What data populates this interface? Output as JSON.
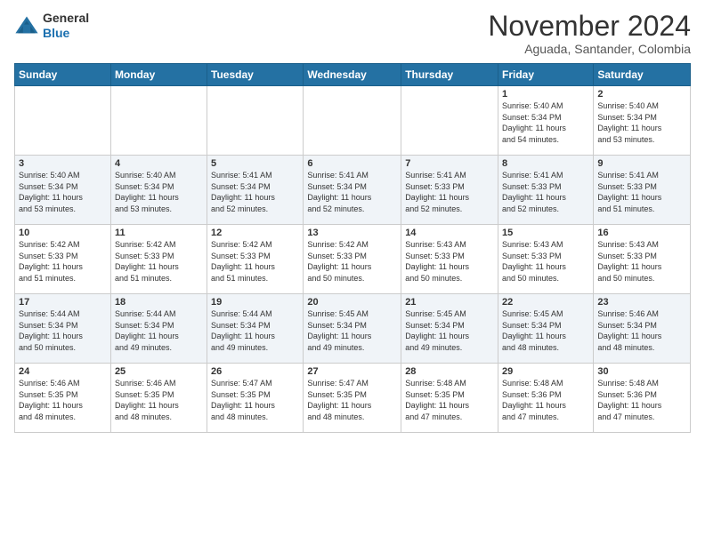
{
  "header": {
    "logo_general": "General",
    "logo_blue": "Blue",
    "month": "November 2024",
    "location": "Aguada, Santander, Colombia"
  },
  "calendar": {
    "days_of_week": [
      "Sunday",
      "Monday",
      "Tuesday",
      "Wednesday",
      "Thursday",
      "Friday",
      "Saturday"
    ],
    "weeks": [
      [
        {
          "day": "",
          "info": ""
        },
        {
          "day": "",
          "info": ""
        },
        {
          "day": "",
          "info": ""
        },
        {
          "day": "",
          "info": ""
        },
        {
          "day": "",
          "info": ""
        },
        {
          "day": "1",
          "info": "Sunrise: 5:40 AM\nSunset: 5:34 PM\nDaylight: 11 hours\nand 54 minutes."
        },
        {
          "day": "2",
          "info": "Sunrise: 5:40 AM\nSunset: 5:34 PM\nDaylight: 11 hours\nand 53 minutes."
        }
      ],
      [
        {
          "day": "3",
          "info": "Sunrise: 5:40 AM\nSunset: 5:34 PM\nDaylight: 11 hours\nand 53 minutes."
        },
        {
          "day": "4",
          "info": "Sunrise: 5:40 AM\nSunset: 5:34 PM\nDaylight: 11 hours\nand 53 minutes."
        },
        {
          "day": "5",
          "info": "Sunrise: 5:41 AM\nSunset: 5:34 PM\nDaylight: 11 hours\nand 52 minutes."
        },
        {
          "day": "6",
          "info": "Sunrise: 5:41 AM\nSunset: 5:34 PM\nDaylight: 11 hours\nand 52 minutes."
        },
        {
          "day": "7",
          "info": "Sunrise: 5:41 AM\nSunset: 5:33 PM\nDaylight: 11 hours\nand 52 minutes."
        },
        {
          "day": "8",
          "info": "Sunrise: 5:41 AM\nSunset: 5:33 PM\nDaylight: 11 hours\nand 52 minutes."
        },
        {
          "day": "9",
          "info": "Sunrise: 5:41 AM\nSunset: 5:33 PM\nDaylight: 11 hours\nand 51 minutes."
        }
      ],
      [
        {
          "day": "10",
          "info": "Sunrise: 5:42 AM\nSunset: 5:33 PM\nDaylight: 11 hours\nand 51 minutes."
        },
        {
          "day": "11",
          "info": "Sunrise: 5:42 AM\nSunset: 5:33 PM\nDaylight: 11 hours\nand 51 minutes."
        },
        {
          "day": "12",
          "info": "Sunrise: 5:42 AM\nSunset: 5:33 PM\nDaylight: 11 hours\nand 51 minutes."
        },
        {
          "day": "13",
          "info": "Sunrise: 5:42 AM\nSunset: 5:33 PM\nDaylight: 11 hours\nand 50 minutes."
        },
        {
          "day": "14",
          "info": "Sunrise: 5:43 AM\nSunset: 5:33 PM\nDaylight: 11 hours\nand 50 minutes."
        },
        {
          "day": "15",
          "info": "Sunrise: 5:43 AM\nSunset: 5:33 PM\nDaylight: 11 hours\nand 50 minutes."
        },
        {
          "day": "16",
          "info": "Sunrise: 5:43 AM\nSunset: 5:33 PM\nDaylight: 11 hours\nand 50 minutes."
        }
      ],
      [
        {
          "day": "17",
          "info": "Sunrise: 5:44 AM\nSunset: 5:34 PM\nDaylight: 11 hours\nand 50 minutes."
        },
        {
          "day": "18",
          "info": "Sunrise: 5:44 AM\nSunset: 5:34 PM\nDaylight: 11 hours\nand 49 minutes."
        },
        {
          "day": "19",
          "info": "Sunrise: 5:44 AM\nSunset: 5:34 PM\nDaylight: 11 hours\nand 49 minutes."
        },
        {
          "day": "20",
          "info": "Sunrise: 5:45 AM\nSunset: 5:34 PM\nDaylight: 11 hours\nand 49 minutes."
        },
        {
          "day": "21",
          "info": "Sunrise: 5:45 AM\nSunset: 5:34 PM\nDaylight: 11 hours\nand 49 minutes."
        },
        {
          "day": "22",
          "info": "Sunrise: 5:45 AM\nSunset: 5:34 PM\nDaylight: 11 hours\nand 48 minutes."
        },
        {
          "day": "23",
          "info": "Sunrise: 5:46 AM\nSunset: 5:34 PM\nDaylight: 11 hours\nand 48 minutes."
        }
      ],
      [
        {
          "day": "24",
          "info": "Sunrise: 5:46 AM\nSunset: 5:35 PM\nDaylight: 11 hours\nand 48 minutes."
        },
        {
          "day": "25",
          "info": "Sunrise: 5:46 AM\nSunset: 5:35 PM\nDaylight: 11 hours\nand 48 minutes."
        },
        {
          "day": "26",
          "info": "Sunrise: 5:47 AM\nSunset: 5:35 PM\nDaylight: 11 hours\nand 48 minutes."
        },
        {
          "day": "27",
          "info": "Sunrise: 5:47 AM\nSunset: 5:35 PM\nDaylight: 11 hours\nand 48 minutes."
        },
        {
          "day": "28",
          "info": "Sunrise: 5:48 AM\nSunset: 5:35 PM\nDaylight: 11 hours\nand 47 minutes."
        },
        {
          "day": "29",
          "info": "Sunrise: 5:48 AM\nSunset: 5:36 PM\nDaylight: 11 hours\nand 47 minutes."
        },
        {
          "day": "30",
          "info": "Sunrise: 5:48 AM\nSunset: 5:36 PM\nDaylight: 11 hours\nand 47 minutes."
        }
      ]
    ]
  }
}
